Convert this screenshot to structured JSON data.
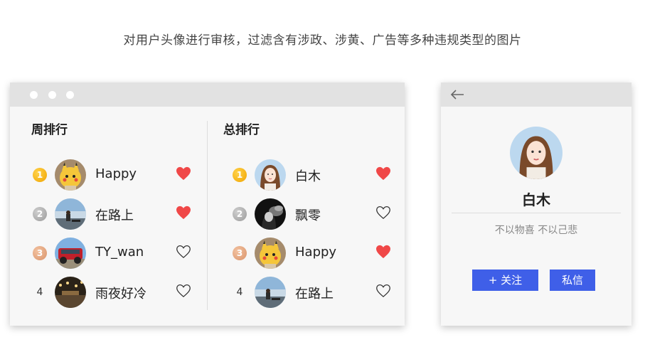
{
  "caption": "对用户头像进行审核，过滤含有涉政、涉黄、广告等多种违规类型的图片",
  "week_ranking": {
    "title": "周排行",
    "entries": [
      {
        "rank": "1",
        "name": "Happy",
        "liked": true
      },
      {
        "rank": "2",
        "name": "在路上",
        "liked": true
      },
      {
        "rank": "3",
        "name": "TY_wan",
        "liked": false
      },
      {
        "rank": "4",
        "name": "雨夜好冷",
        "liked": false
      }
    ]
  },
  "total_ranking": {
    "title": "总排行",
    "entries": [
      {
        "rank": "1",
        "name": "白木",
        "liked": true
      },
      {
        "rank": "2",
        "name": "飘零",
        "liked": false
      },
      {
        "rank": "3",
        "name": "Happy",
        "liked": true
      },
      {
        "rank": "4",
        "name": "在路上",
        "liked": false
      }
    ]
  },
  "profile": {
    "name": "白木",
    "bio": "不以物喜 不以己悲",
    "follow_label": "+ 关注",
    "message_label": "私信"
  },
  "colors": {
    "accent": "#3f5fe8",
    "heart_filled": "#f04848",
    "rank_gold": "#f0a400",
    "rank_silver": "#9a9a9a",
    "rank_bronze": "#d9936a"
  }
}
